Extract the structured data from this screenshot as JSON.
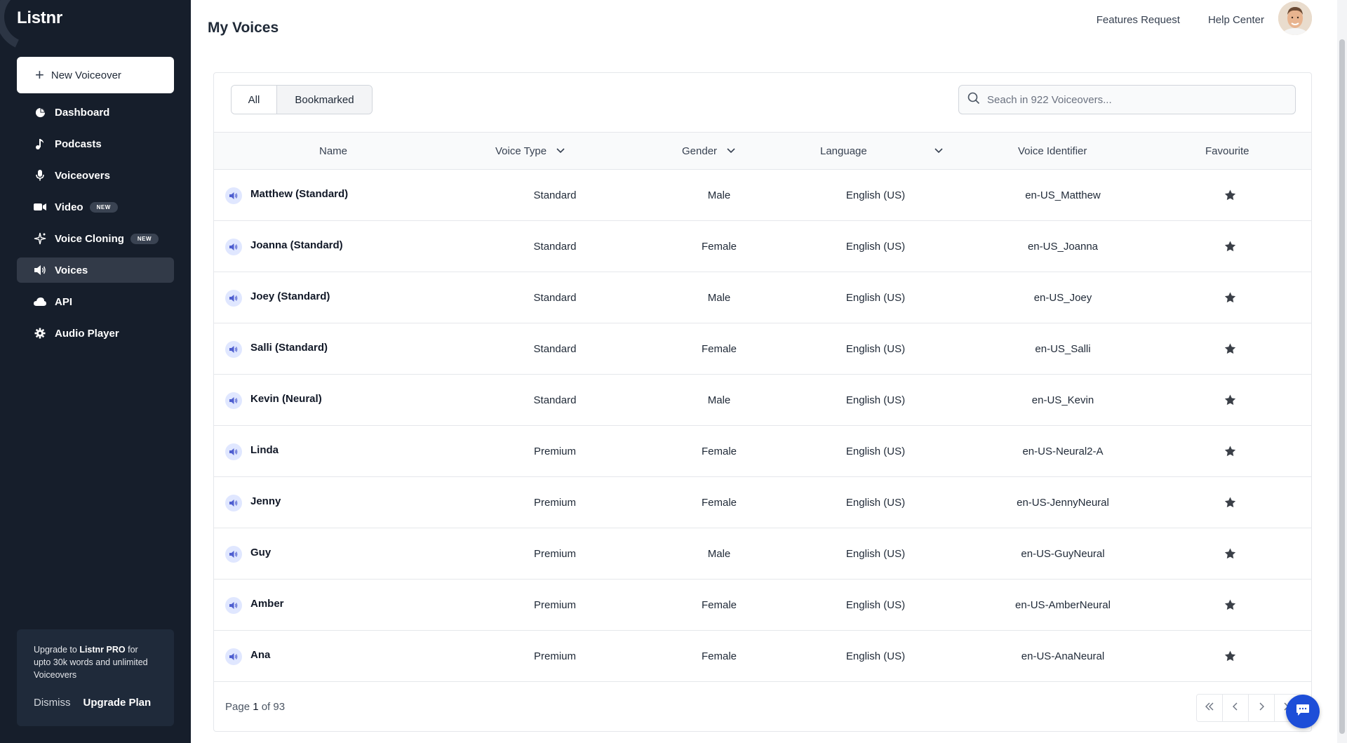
{
  "sidebar": {
    "brand": "Listnr",
    "new_voiceover": "New Voiceover",
    "items": [
      {
        "label": "Dashboard",
        "icon": "pie-chart-icon"
      },
      {
        "label": "Podcasts",
        "icon": "music-note-icon"
      },
      {
        "label": "Voiceovers",
        "icon": "microphone-icon"
      },
      {
        "label": "Video",
        "icon": "video-camera-icon",
        "badge": "NEW"
      },
      {
        "label": "Voice Cloning",
        "icon": "sparkles-icon",
        "badge": "NEW"
      },
      {
        "label": "Voices",
        "icon": "speaker-icon",
        "active": true
      },
      {
        "label": "API",
        "icon": "cloud-icon"
      },
      {
        "label": "Audio Player",
        "icon": "gear-icon"
      }
    ],
    "upgrade": {
      "text_prefix": "Upgrade to ",
      "text_brand": "Listnr PRO",
      "text_suffix": " for upto 30k words and unlimited Voiceovers",
      "dismiss": "Dismiss",
      "upgrade_plan": "Upgrade Plan"
    }
  },
  "header": {
    "title": "My Voices",
    "features_request": "Features Request",
    "help_center": "Help Center"
  },
  "tabs": {
    "all": "All",
    "bookmarked": "Bookmarked"
  },
  "search": {
    "placeholder": "Seach in 922 Voiceovers..."
  },
  "table": {
    "columns": {
      "name": "Name",
      "voice_type": "Voice Type",
      "gender": "Gender",
      "language": "Language",
      "voice_identifier": "Voice Identifier",
      "favourite": "Favourite"
    },
    "rows": [
      {
        "name": "Matthew (Standard)",
        "type": "Standard",
        "gender": "Male",
        "language": "English (US)",
        "id": "en-US_Matthew"
      },
      {
        "name": "Joanna (Standard)",
        "type": "Standard",
        "gender": "Female",
        "language": "English (US)",
        "id": "en-US_Joanna"
      },
      {
        "name": "Joey (Standard)",
        "type": "Standard",
        "gender": "Male",
        "language": "English (US)",
        "id": "en-US_Joey"
      },
      {
        "name": "Salli (Standard)",
        "type": "Standard",
        "gender": "Female",
        "language": "English (US)",
        "id": "en-US_Salli"
      },
      {
        "name": "Kevin (Neural)",
        "type": "Standard",
        "gender": "Male",
        "language": "English (US)",
        "id": "en-US_Kevin"
      },
      {
        "name": "Linda",
        "type": "Premium",
        "gender": "Female",
        "language": "English (US)",
        "id": "en-US-Neural2-A"
      },
      {
        "name": "Jenny",
        "type": "Premium",
        "gender": "Female",
        "language": "English (US)",
        "id": "en-US-JennyNeural"
      },
      {
        "name": "Guy",
        "type": "Premium",
        "gender": "Male",
        "language": "English (US)",
        "id": "en-US-GuyNeural"
      },
      {
        "name": "Amber",
        "type": "Premium",
        "gender": "Female",
        "language": "English (US)",
        "id": "en-US-AmberNeural"
      },
      {
        "name": "Ana",
        "type": "Premium",
        "gender": "Female",
        "language": "English (US)",
        "id": "en-US-AnaNeural"
      }
    ]
  },
  "pagination": {
    "prefix": "Page ",
    "current": "1",
    "middle": " of ",
    "total": "93"
  },
  "colors": {
    "sidebar_bg": "#161e2b",
    "active_item": "#323a48",
    "accent": "#1d4ed8"
  }
}
